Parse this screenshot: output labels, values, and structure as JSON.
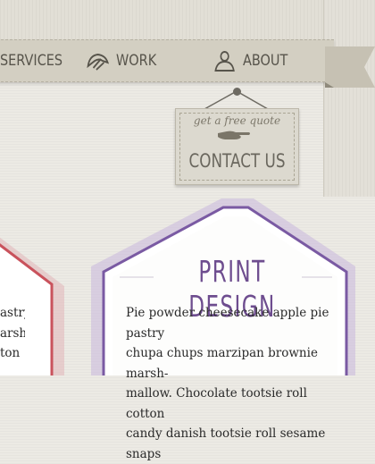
{
  "nav": {
    "items": [
      {
        "label": "SERVICES",
        "icon": "services-icon"
      },
      {
        "label": "WORK",
        "icon": "work-icon"
      },
      {
        "label": "ABOUT",
        "icon": "about-icon"
      }
    ]
  },
  "quote": {
    "tagline": "get a free quote",
    "button_label": "CONTACT US",
    "hand_icon": "pointing-hand-icon"
  },
  "cards": {
    "left": {
      "lines": [
        "astry",
        "arsh-",
        "ton"
      ],
      "accent": "#c9525c"
    },
    "print": {
      "title": "PRINT DESIGN",
      "lines": [
        "Pie powder cheesecake apple pie pastry",
        "chupa chups marzipan brownie marsh-",
        "mallow. Chocolate tootsie roll cotton",
        "candy danish tootsie roll sesame snaps"
      ],
      "accent": "#7a5aa3"
    }
  },
  "colors": {
    "title": "#6e4d8f",
    "nav_text": "#57544b",
    "paper": "#eceae4"
  }
}
